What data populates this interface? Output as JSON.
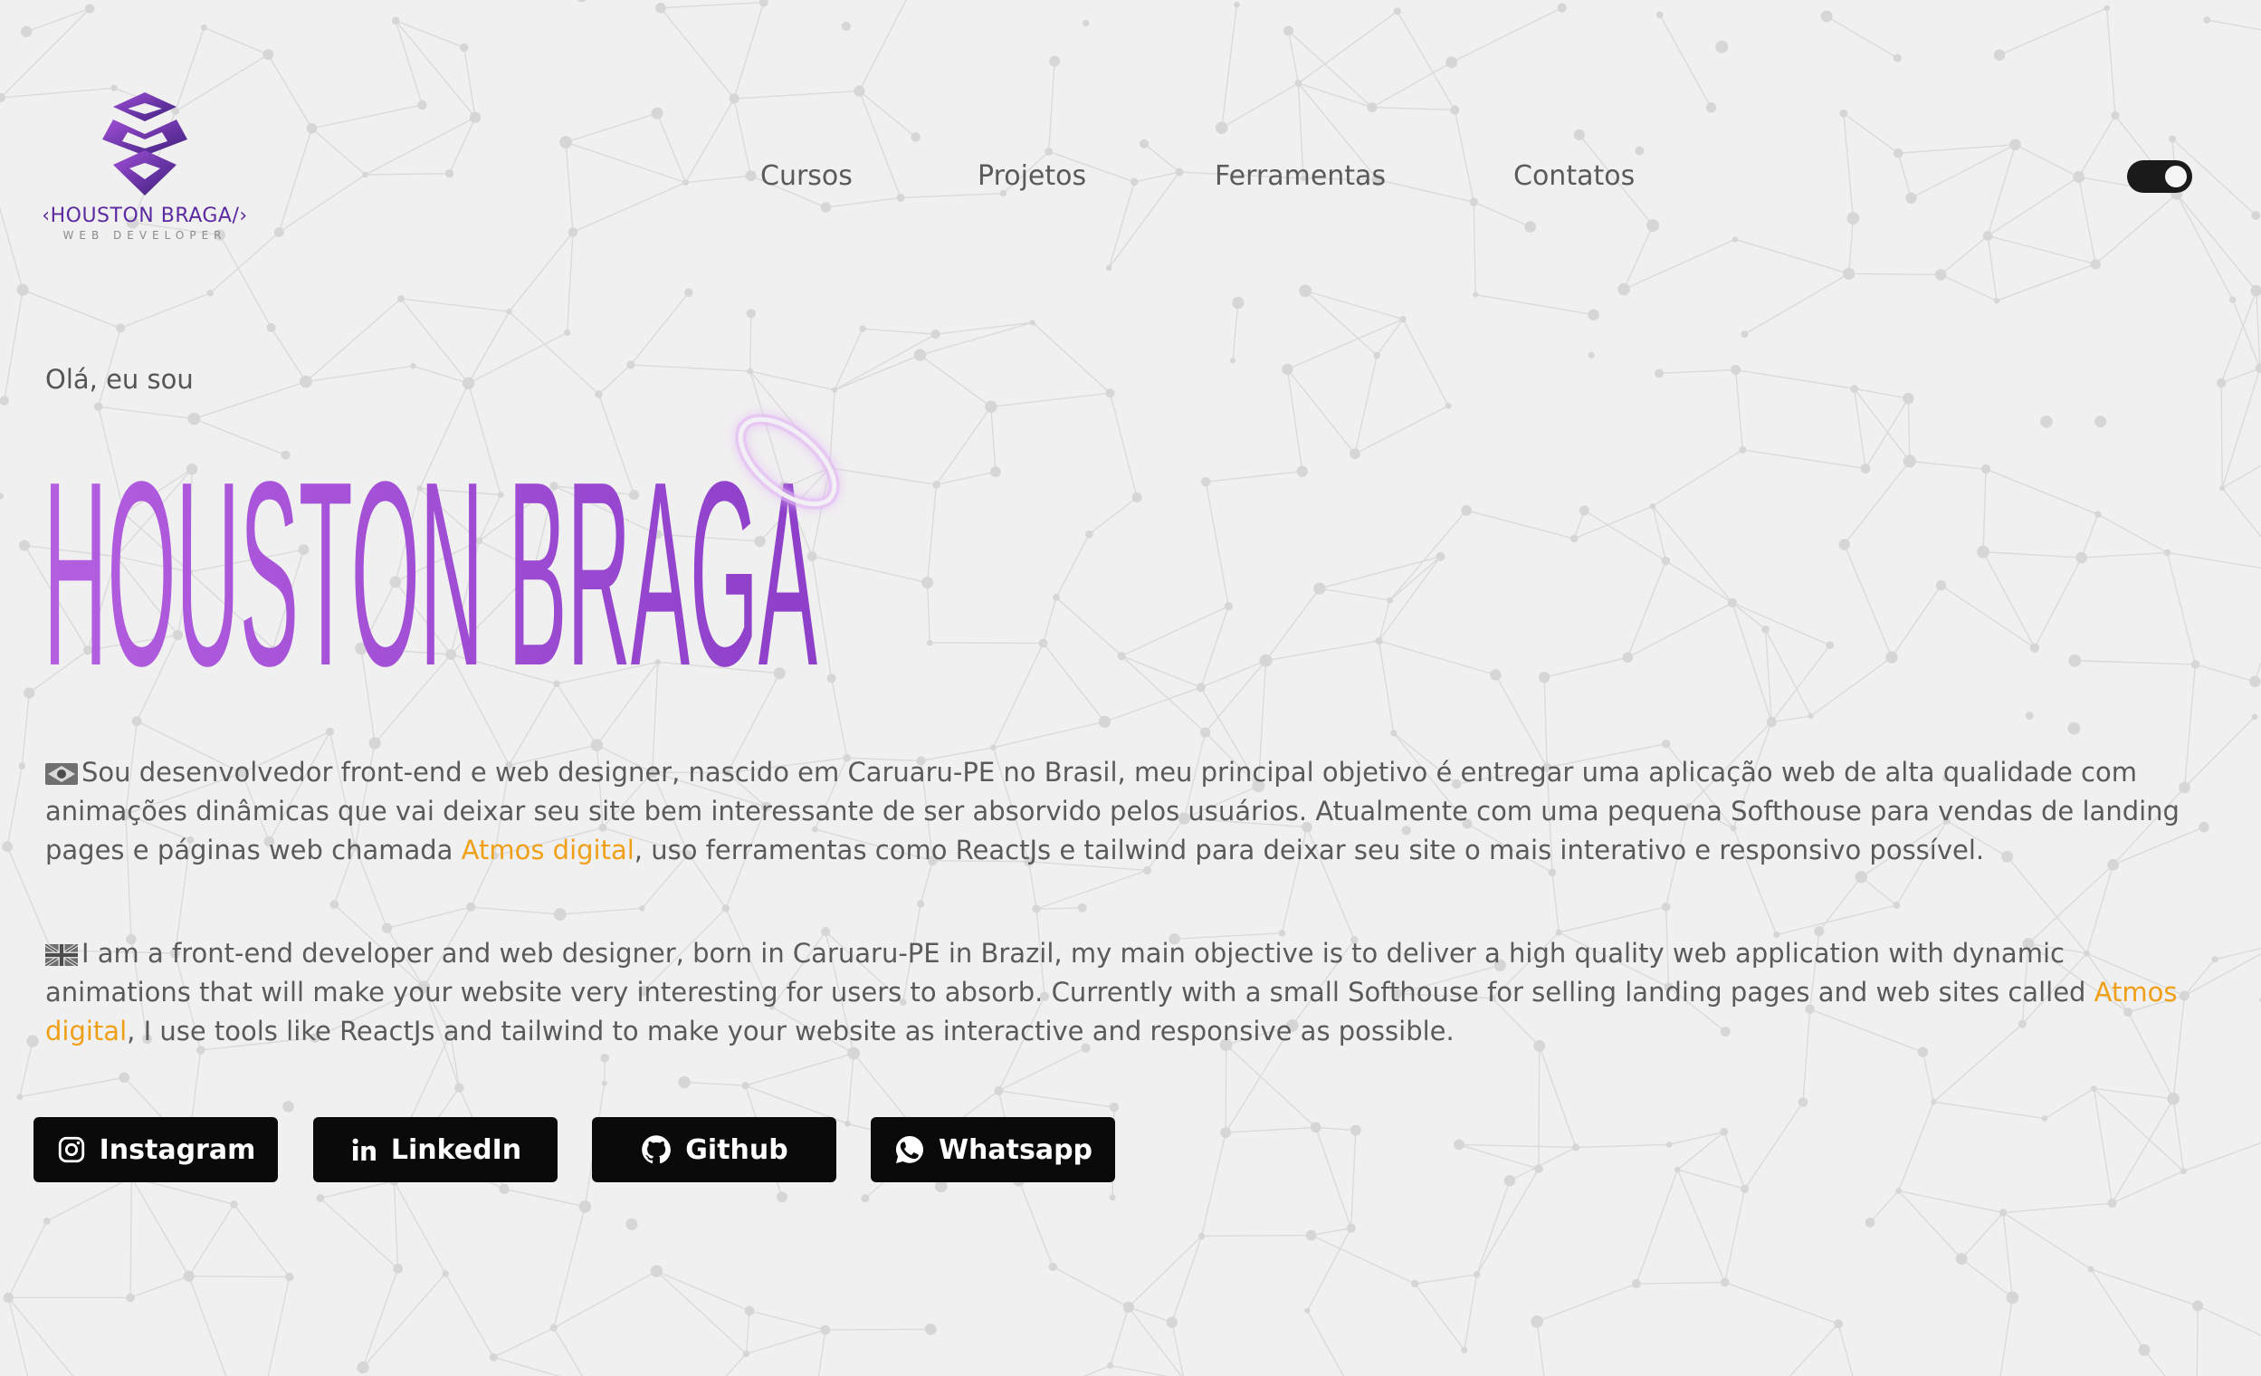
{
  "theme": {
    "accent": "#9b4fd6",
    "accent_dark": "#5b2aa0",
    "link": "#f0a018",
    "background": "#f0f0f0",
    "button_bg": "#0a0a0a"
  },
  "logo": {
    "name": "‹HOUSTON BRAGA/›",
    "subtitle": "WEB DEVELOPER"
  },
  "nav": {
    "items": [
      {
        "label": "Cursos"
      },
      {
        "label": "Projetos"
      },
      {
        "label": "Ferramentas"
      },
      {
        "label": "Contatos"
      }
    ]
  },
  "theme_toggle": {
    "state": "on",
    "icon": "toggle-icon"
  },
  "hero": {
    "greeting": "Olá, eu sou",
    "name": "HOUSTON BRAGA"
  },
  "about_pt": {
    "flag_icon": "brazil-flag-icon",
    "text_before": "Sou desenvolvedor front-end e web designer, nascido em Caruaru-PE no Brasil, meu principal objetivo é entregar uma aplicação web de alta qualidade com animações dinâmicas que vai deixar seu site bem interessante de ser absorvido pelos usuários. Atualmente com uma pequena Softhouse para vendas de landing pages e páginas web chamada ",
    "link": "Atmos digital",
    "text_after": ", uso ferramentas como ReactJs e tailwind para deixar seu site o mais interativo e responsivo possível."
  },
  "about_en": {
    "flag_icon": "uk-flag-icon",
    "text_before": "I am a front-end developer and web designer, born in Caruaru-PE in Brazil, my main objective is to deliver a high quality web application with dynamic animations that will make your website very interesting for users to absorb. Currently with a small Softhouse for selling landing pages and web sites called ",
    "link": "Atmos digital",
    "text_after": ", I use tools like ReactJs and tailwind to make your website as interactive and responsive as possible."
  },
  "social": [
    {
      "label": "Instagram",
      "icon": "instagram-icon"
    },
    {
      "label": "LinkedIn",
      "icon": "linkedin-icon"
    },
    {
      "label": "Github",
      "icon": "github-icon"
    },
    {
      "label": "Whatsapp",
      "icon": "whatsapp-icon"
    }
  ]
}
